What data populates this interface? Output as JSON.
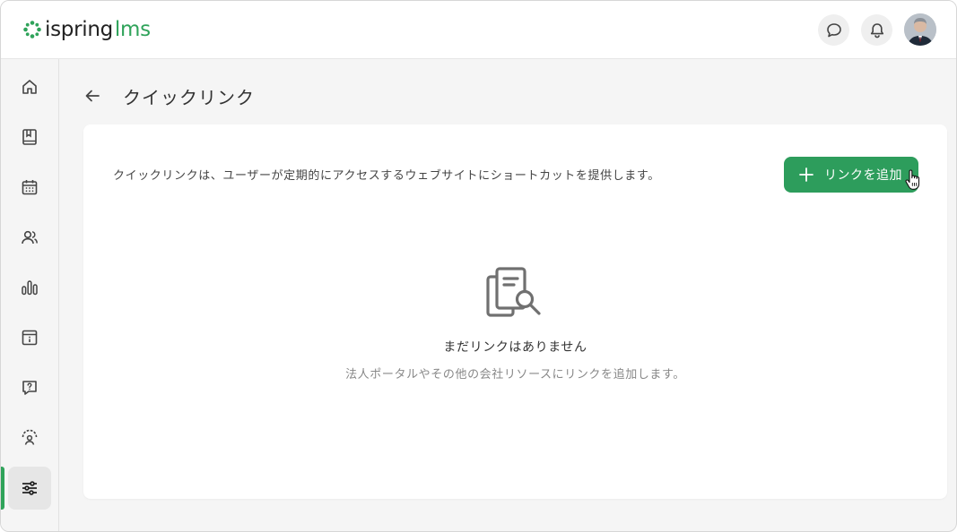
{
  "app": {
    "logo_text_1": "ispring",
    "logo_text_2": "lms"
  },
  "header": {
    "chat_icon": "chat-bubble-icon",
    "notification_icon": "bell-icon"
  },
  "sidebar": {
    "items": [
      {
        "id": "home",
        "icon": "home-icon"
      },
      {
        "id": "library",
        "icon": "book-icon"
      },
      {
        "id": "calendar",
        "icon": "calendar-icon"
      },
      {
        "id": "users",
        "icon": "users-icon"
      },
      {
        "id": "reports",
        "icon": "bar-chart-icon"
      },
      {
        "id": "info",
        "icon": "info-calendar-icon"
      },
      {
        "id": "help",
        "icon": "question-chat-icon"
      },
      {
        "id": "feedback",
        "icon": "user-feedback-icon"
      },
      {
        "id": "settings",
        "icon": "sliders-icon",
        "active": true
      }
    ]
  },
  "page": {
    "title": "クイックリンク",
    "description": "クイックリンクは、ユーザーが定期的にアクセスするウェブサイトにショートカットを提供します。",
    "add_button_label": "リンクを追加",
    "empty_title": "まだリンクはありません",
    "empty_subtitle": "法人ポータルやその他の会社リソースにリンクを追加します。"
  },
  "colors": {
    "accent": "#2fa35a",
    "button": "#2d9d5c"
  }
}
